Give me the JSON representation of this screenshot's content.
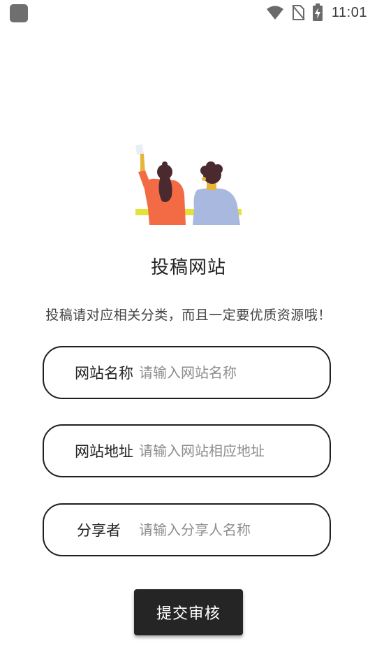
{
  "status_bar": {
    "time": "11:01",
    "icons": [
      "wifi-icon",
      "no-sim-icon",
      "battery-charging-icon"
    ]
  },
  "illustration": {
    "name": "two-people-illustration",
    "colors": {
      "woman_shirt": "#f26b45",
      "man_shirt": "#a9b8de",
      "desk": "#e2e23a",
      "hair": "#4a2a2e",
      "skin": "#e8b43a"
    }
  },
  "page": {
    "title": "投稿网站",
    "subtitle": "投稿请对应相关分类，而且一定要优质资源哦！"
  },
  "form": {
    "site_name": {
      "label": "网站名称",
      "placeholder": "请输入网站名称",
      "value": ""
    },
    "site_url": {
      "label": "网站地址",
      "placeholder": "请输入网站相应地址",
      "value": ""
    },
    "sharer": {
      "label": "分享者",
      "placeholder": "请输入分享人名称",
      "value": ""
    }
  },
  "submit": {
    "label": "提交审核"
  }
}
